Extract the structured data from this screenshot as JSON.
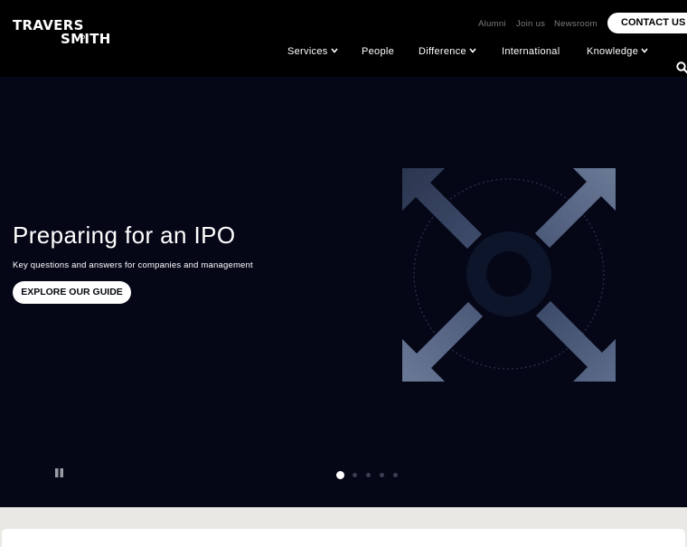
{
  "brand": {
    "line1": "TRAVERS",
    "ampersand": "o",
    "line2": "SMITH"
  },
  "utility_links": [
    "Alumni",
    "Join us",
    "Newsroom"
  ],
  "contact_label": "CONTACT US",
  "nav": [
    {
      "label": "Services",
      "has_dropdown": true
    },
    {
      "label": "People",
      "has_dropdown": false
    },
    {
      "label": "Difference",
      "has_dropdown": true
    },
    {
      "label": "International",
      "has_dropdown": false
    },
    {
      "label": "Knowledge",
      "has_dropdown": true
    }
  ],
  "icons": {
    "search": "search-icon",
    "pause": "pause-icon",
    "chevron": "chevron-down-icon"
  },
  "hero": {
    "title": "Preparing for an IPO",
    "subtitle": "Key questions and answers for companies and management",
    "cta": "EXPLORE OUR GUIDE"
  },
  "carousel": {
    "slide_count": 5,
    "active_index": 0
  },
  "colors": {
    "header": "#000000",
    "hero": "#050717",
    "arrows_light": "#6a7996",
    "arrows_dark": "#2b3650",
    "ring": "#0d152b"
  }
}
